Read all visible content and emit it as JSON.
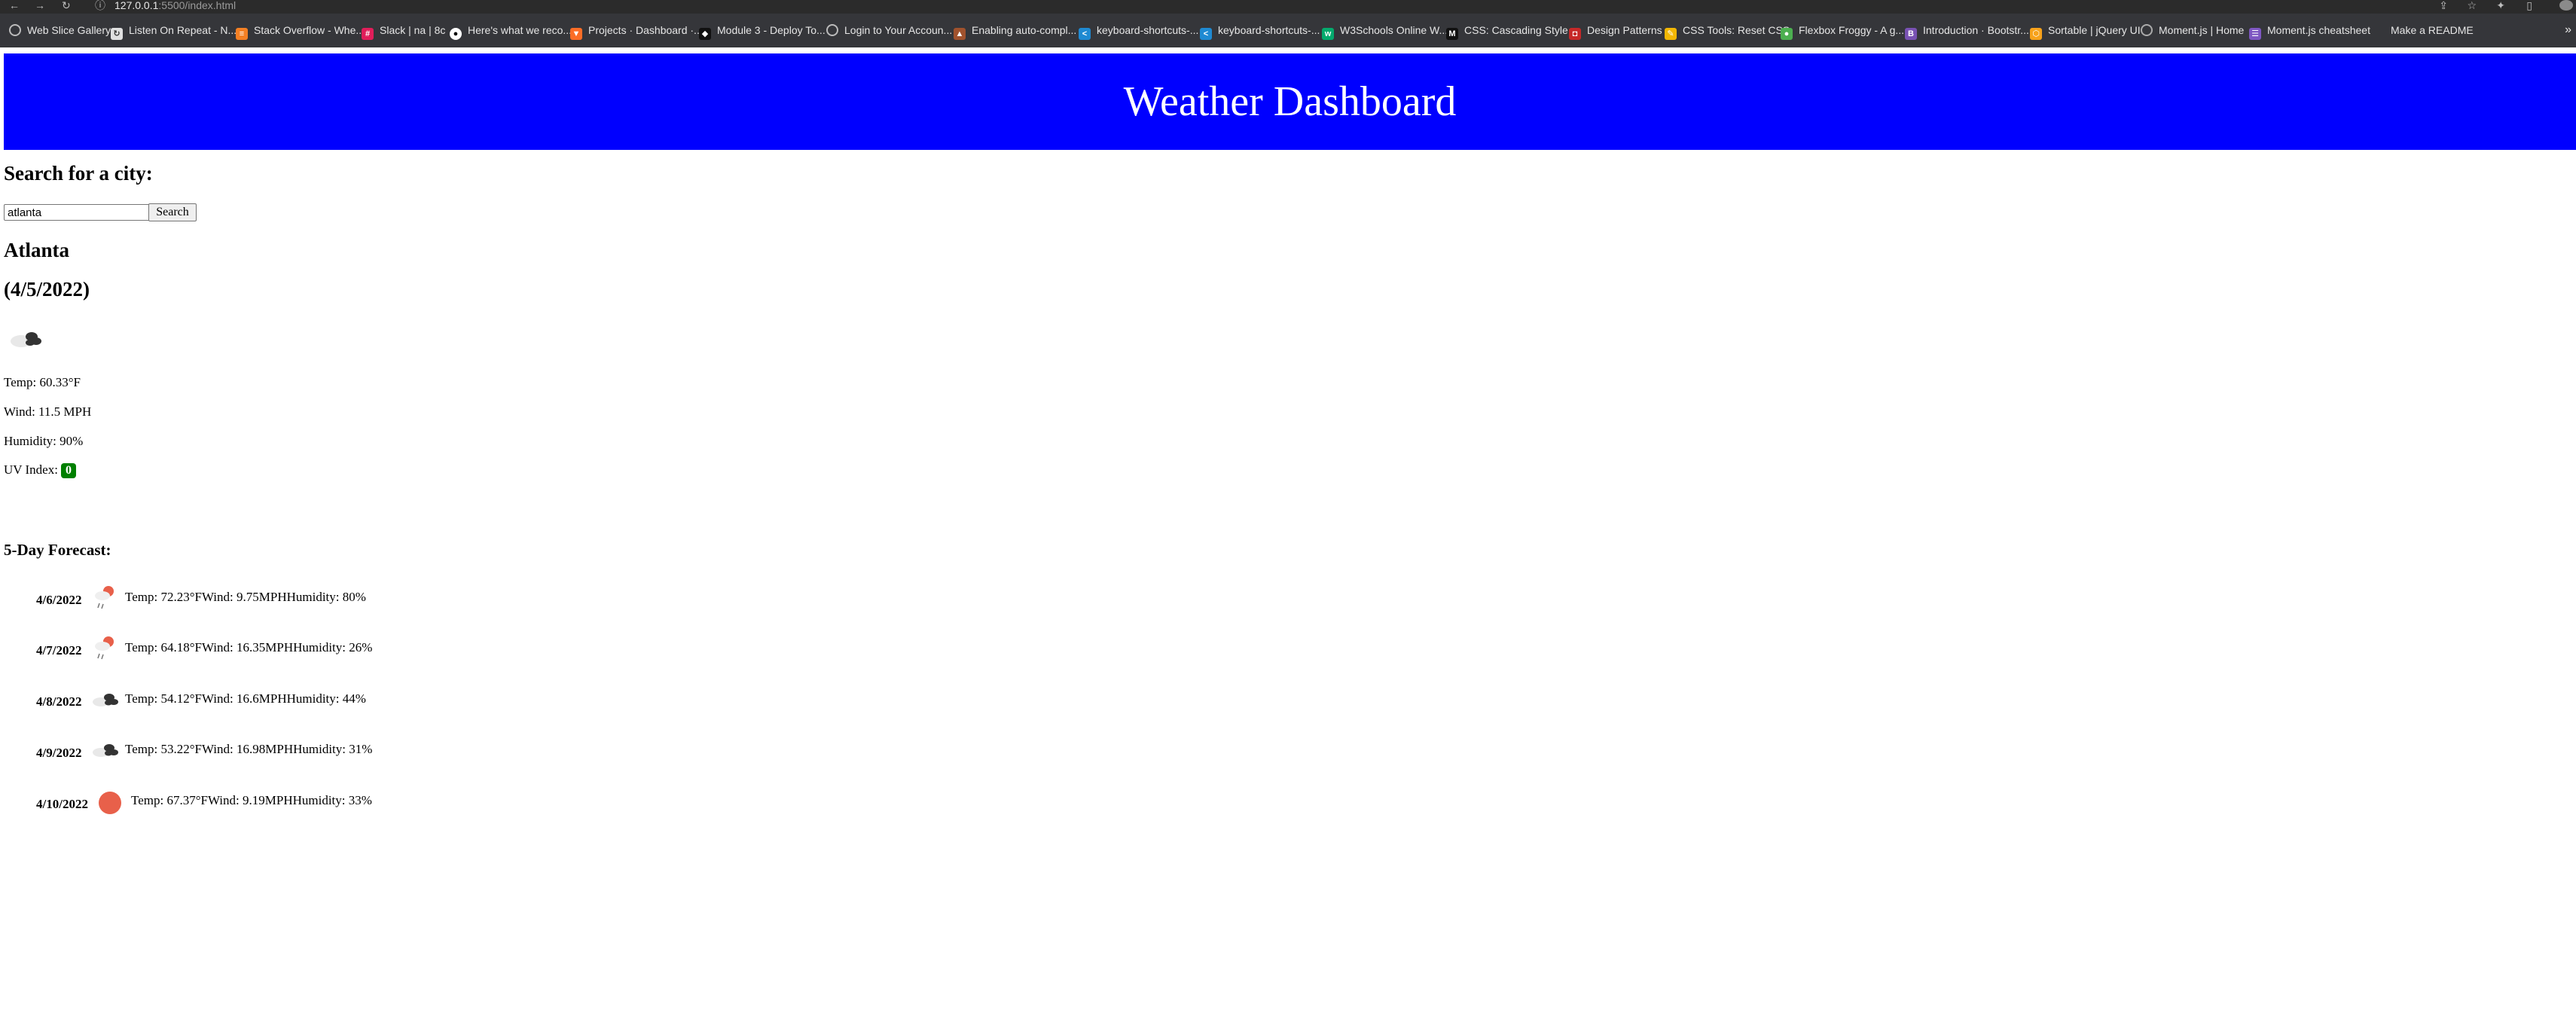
{
  "browser": {
    "url_host": "127.0.0.1",
    "url_path": ":5500/index.html",
    "bookmarks": [
      {
        "label": "Web Slice Gallery",
        "icon": "globe-icon",
        "color": "#9e9e9e"
      },
      {
        "label": "Listen On Repeat - N...",
        "icon": "repeat-icon",
        "color": "#e0e0e0"
      },
      {
        "label": "Stack Overflow - Whe...",
        "icon": "stack-overflow-icon",
        "color": "#f48024"
      },
      {
        "label": "Slack | na | 8c",
        "icon": "slack-icon",
        "color": "#e01e5a"
      },
      {
        "label": "Here's what we reco...",
        "icon": "github-icon",
        "color": "#ffffff"
      },
      {
        "label": "Projects · Dashboard ·...",
        "icon": "gitlab-icon",
        "color": "#fc6d26"
      },
      {
        "label": "Module 3 - Deploy To...",
        "icon": "canvas-icon",
        "color": "#111111"
      },
      {
        "label": "Login to Your Accoun...",
        "icon": "globe-icon",
        "color": "#9e9e9e"
      },
      {
        "label": "Enabling auto-compl...",
        "icon": "bookmark-icon",
        "color": "#a0522d"
      },
      {
        "label": "keyboard-shortcuts-...",
        "icon": "vscode-icon",
        "color": "#1f8ad2"
      },
      {
        "label": "keyboard-shortcuts-...",
        "icon": "vscode-icon",
        "color": "#1f8ad2"
      },
      {
        "label": "W3Schools Online W...",
        "icon": "w3schools-icon",
        "color": "#04aa6d"
      },
      {
        "label": "CSS: Cascading Style...",
        "icon": "mdn-icon",
        "color": "#111111"
      },
      {
        "label": "Design Patterns",
        "icon": "design-patterns-icon",
        "color": "#c62828"
      },
      {
        "label": "CSS Tools: Reset CSS",
        "icon": "css-tools-icon",
        "color": "#f2b705"
      },
      {
        "label": "Flexbox Froggy - A g...",
        "icon": "froggy-icon",
        "color": "#4caf50"
      },
      {
        "label": "Introduction · Bootstr...",
        "icon": "bootstrap-icon",
        "color": "#7952b3"
      },
      {
        "label": "Sortable | jQuery UI",
        "icon": "jquery-icon",
        "color": "#f7a21b"
      },
      {
        "label": "Moment.js | Home",
        "icon": "moment-icon",
        "color": "#9e9e9e"
      },
      {
        "label": "Moment.js cheatsheet",
        "icon": "devhints-icon",
        "color": "#7e57c2"
      },
      {
        "label": "Make a README",
        "icon": "",
        "color": ""
      }
    ],
    "more_bookmarks": "»"
  },
  "header": {
    "title": "Weather Dashboard"
  },
  "search": {
    "heading": "Search for a city:",
    "value": "atlanta",
    "button_label": "Search"
  },
  "current": {
    "city": "Atlanta",
    "date": "(4/5/2022)",
    "icon": "broken-clouds-icon",
    "temp": "Temp: 60.33°F",
    "wind": "Wind: 11.5 MPH",
    "humidity": "Humidity: 90%",
    "uv_label": "UV Index:",
    "uv_value": "0",
    "uv_color": "#008000"
  },
  "forecast": {
    "heading": "5-Day Forecast:",
    "days": [
      {
        "date": "4/6/2022",
        "icon": "rain-sun-icon",
        "text": "Temp: 72.23°FWind: 9.75MPHHumidity: 80%"
      },
      {
        "date": "4/7/2022",
        "icon": "rain-sun-icon",
        "text": "Temp: 64.18°FWind: 16.35MPHHumidity: 26%"
      },
      {
        "date": "4/8/2022",
        "icon": "broken-clouds-icon",
        "text": "Temp: 54.12°FWind: 16.6MPHHumidity: 44%"
      },
      {
        "date": "4/9/2022",
        "icon": "broken-clouds-icon",
        "text": "Temp: 53.22°FWind: 16.98MPHHumidity: 31%"
      },
      {
        "date": "4/10/2022",
        "icon": "clear-sun-icon",
        "text": "Temp: 67.37°FWind: 9.19MPHHumidity: 33%"
      }
    ]
  }
}
